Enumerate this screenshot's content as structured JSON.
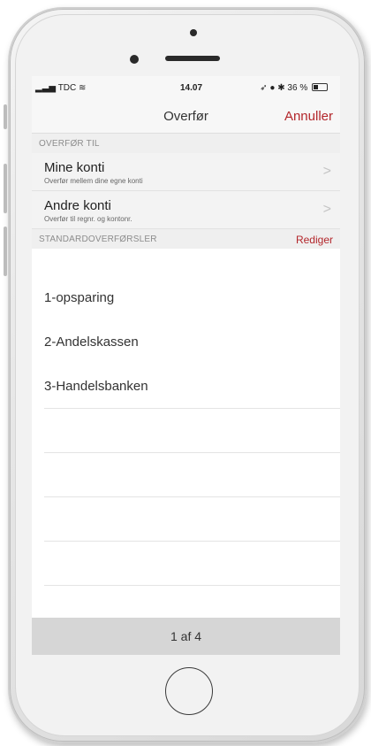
{
  "status_bar": {
    "carrier": "TDC",
    "time": "14.07",
    "battery": "36 %"
  },
  "nav": {
    "title": "Overfør",
    "cancel": "Annuller"
  },
  "section_transfer_to": {
    "header": "OVERFØR TIL",
    "items": [
      {
        "title": "Mine konti",
        "subtitle": "Overfør mellem dine egne konti"
      },
      {
        "title": "Andre konti",
        "subtitle": "Overfør til regnr. og kontonr."
      }
    ]
  },
  "section_standard": {
    "header": "STANDARDOVERFØRSLER",
    "edit": "Rediger",
    "items": [
      {
        "label": "1-opsparing"
      },
      {
        "label": "2-Andelskassen"
      },
      {
        "label": "3-Handelsbanken"
      }
    ]
  },
  "pager": {
    "text": "1 af 4"
  },
  "icons": {
    "chevron": "chevron-right-icon",
    "signal": "signal-icon",
    "wifi": "wifi-icon",
    "battery": "battery-icon"
  },
  "colors": {
    "accent": "#b3262b"
  }
}
